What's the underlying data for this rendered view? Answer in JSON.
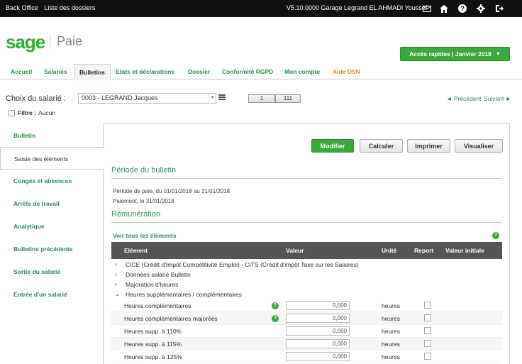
{
  "topbar": {
    "links": [
      "Back Office",
      "Liste des dossiers"
    ],
    "info": "V5.10.0000  Garage Legrand EL AHMADI Youssef"
  },
  "brand": {
    "name": "sage",
    "app": "Paie"
  },
  "quick": {
    "label": "Accès rapides | Janvier 2018"
  },
  "nav": [
    "Accueil",
    "Salariés",
    "Bulletins",
    "Etats et déclarations",
    "Dossier",
    "Conformité RGPD",
    "Mon compte",
    "Aide DSN"
  ],
  "employee": {
    "label": "Choix du salarié :",
    "selected": "0003 - LEGRAND Jacques",
    "mode_one": "1",
    "mode_all": "111",
    "prev": "◄ Précédent",
    "next": "Suivant ►"
  },
  "filter": {
    "label": "Filtre :",
    "value": "Aucun"
  },
  "side": [
    "Bulletin",
    "Saisie des éléments",
    "Congés et absences",
    "Arrêts de travail",
    "Analytique",
    "Bulletins précédents",
    "Sortie du salarié",
    "Entrée d'un salarié"
  ],
  "actions": {
    "modifier": "Modifier",
    "calculer": "Calculer",
    "imprimer": "Imprimer",
    "visualiser": "Visualiser"
  },
  "periode": {
    "title": "Période du bulletin",
    "line1": "Période de paie, du 01/01/2018 au 31/01/2018",
    "line2": "Paiement, le 31/01/2018"
  },
  "remuneration": {
    "title": "Rémunération",
    "voir": "Voir tous les éléments"
  },
  "table": {
    "headers": {
      "element": "Elément",
      "valeur": "Valeur",
      "unite": "Unité",
      "report": "Report",
      "valeur_initiale": "Valeur initiale"
    },
    "groups": [
      {
        "label": "CICE (Crédit d'Impôt Compétitivité Emploi) - CITS (Crédit d'impôt Taxe sur les Salaires)",
        "expanded": false
      },
      {
        "label": "Données salarié Bulletin",
        "expanded": false
      },
      {
        "label": "Majoration d'heures",
        "expanded": false
      },
      {
        "label": "Heures supplémentaires / complémentaires",
        "expanded": true
      }
    ],
    "rows": [
      {
        "label": "Heures complémentaires",
        "help": true,
        "value": "0,000",
        "unit": "heures"
      },
      {
        "label": "Heures complémentaires majorées",
        "help": true,
        "value": "0,000",
        "unit": "heures"
      },
      {
        "label": "Heures supp. à 110%",
        "help": false,
        "value": "0,000",
        "unit": "heures"
      },
      {
        "label": "Heures supp. à 115%",
        "help": false,
        "value": "0,000",
        "unit": "heures"
      },
      {
        "label": "Heures supp. à 125%",
        "help": false,
        "value": "0,000",
        "unit": "heures"
      }
    ]
  },
  "colors": {
    "brand_green": "#2db42d",
    "link_green": "#2e8b57",
    "accent_orange": "#e08a2b",
    "header_dark": "#555555"
  }
}
